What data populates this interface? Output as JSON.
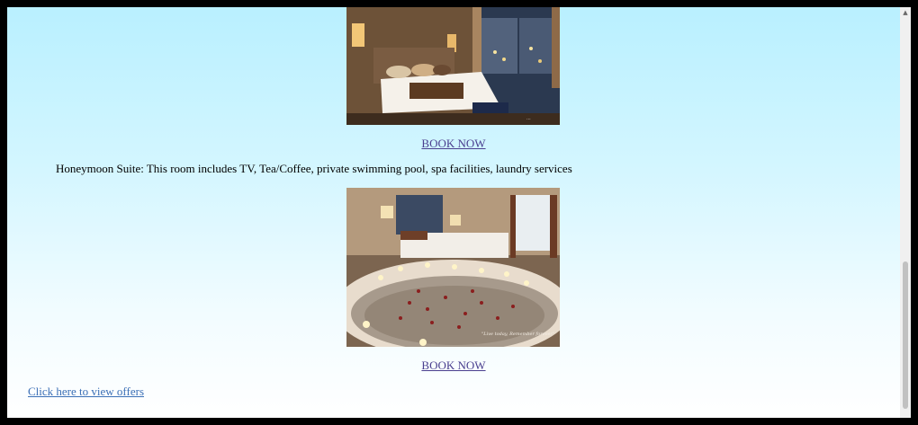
{
  "rooms": [
    {
      "image_label": "Luxury hotel room with city view",
      "book_label": "BOOK NOW"
    },
    {
      "description": "Honeymoon Suite: This room includes TV, Tea/Coffee, private swimming pool, spa facilities, laundry services",
      "image_label": "Honeymoon suite with candlelit rose-petal pool",
      "image_caption": "\"Live today, Remember forever\"",
      "book_label": "BOOK NOW"
    }
  ],
  "offers_link": "Click here to view offers",
  "colors": {
    "gradient_top": "#b9f0ff",
    "gradient_bottom": "#ffffff",
    "link": "#4a3f8f",
    "offers_link": "#3b6fb6"
  }
}
